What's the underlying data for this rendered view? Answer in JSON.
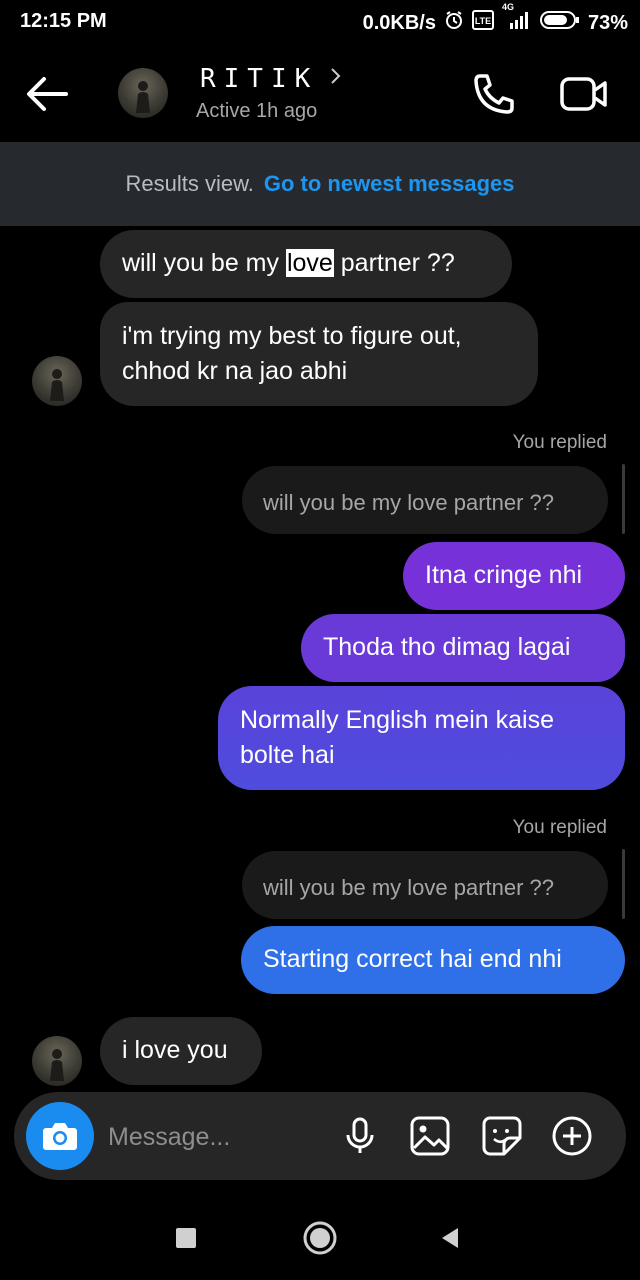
{
  "status_bar": {
    "time": "12:15 PM",
    "net_speed": "0.0KB/s",
    "network_label": "4G",
    "battery": "73%",
    "icons": [
      "alarm-icon",
      "volte-icon",
      "signal-icon",
      "battery-icon"
    ]
  },
  "header": {
    "contact_name": "RITIK",
    "active_status": "Active 1h ago",
    "icons": [
      "back-arrow-icon",
      "chevron-right-icon",
      "phone-icon",
      "video-camera-icon"
    ]
  },
  "banner": {
    "results_text": "Results view.",
    "go_newest": "Go to newest messages"
  },
  "messages": [
    {
      "direction": "incoming",
      "highlight_prefix": "will you be my ",
      "highlight_word": "love",
      "highlight_suffix": " partner ??"
    },
    {
      "direction": "incoming",
      "text": "i'm trying my best to figure out, chhod kr na jao abhi"
    },
    {
      "direction": "outgoing",
      "replied_label": "You replied",
      "reply_to": "will you be my love partner ??"
    },
    {
      "direction": "outgoing",
      "text": "Itna cringe nhi"
    },
    {
      "direction": "outgoing",
      "text": "Thoda tho dimag lagai"
    },
    {
      "direction": "outgoing",
      "text": "Normally English mein kaise bolte hai"
    },
    {
      "direction": "outgoing",
      "replied_label": "You replied",
      "reply_to": "will you be my love partner ??"
    },
    {
      "direction": "outgoing",
      "text": "Starting correct hai end nhi"
    },
    {
      "direction": "incoming",
      "text": "i love you"
    }
  ],
  "composer": {
    "placeholder": "Message...",
    "icons": [
      "camera-icon",
      "microphone-icon",
      "gallery-icon",
      "sticker-icon",
      "plus-icon"
    ]
  },
  "nav_bar": {
    "icons": [
      "recents-square-icon",
      "home-circle-icon",
      "back-triangle-icon"
    ]
  },
  "colors": {
    "accent": "#1c96f0",
    "outgoing_top": "#7a36dc",
    "outgoing_bottom": "#2e6fe6",
    "incoming_bubble": "#262626"
  }
}
